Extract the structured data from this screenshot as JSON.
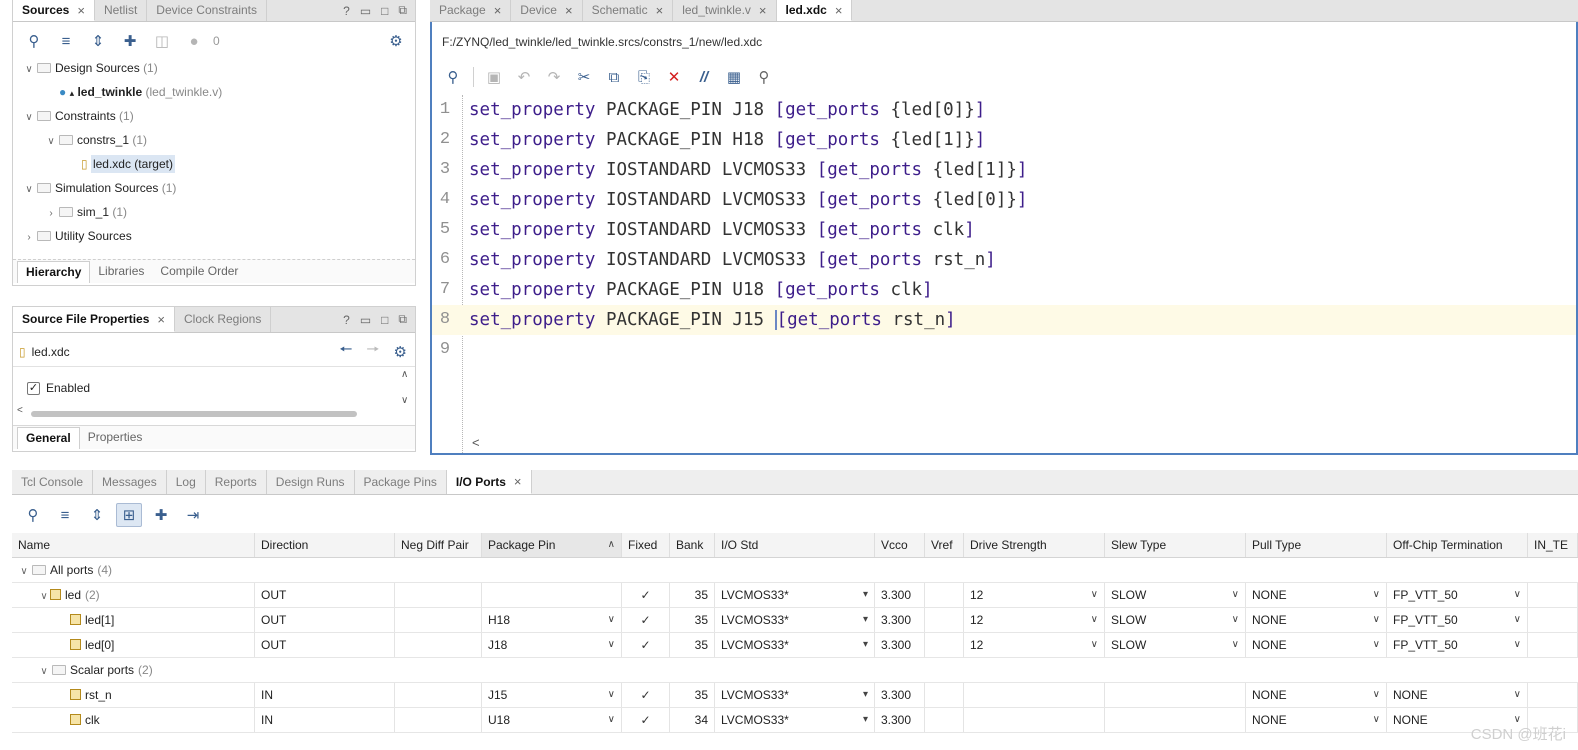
{
  "sources_panel": {
    "tabs": [
      "Sources",
      "Netlist",
      "Device Constraints"
    ],
    "close": "×",
    "win_buttons": [
      "?",
      "▭",
      "□",
      "⧉"
    ],
    "count_badge": "0",
    "tree": [
      {
        "label": "Design Sources",
        "count": "(1)"
      },
      {
        "label": "led_twinkle",
        "suffix": "(led_twinkle.v)"
      },
      {
        "label": "Constraints",
        "count": "(1)"
      },
      {
        "label": "constrs_1",
        "count": "(1)"
      },
      {
        "label": "led.xdc (target)"
      },
      {
        "label": "Simulation Sources",
        "count": "(1)"
      },
      {
        "label": "sim_1",
        "count": "(1)"
      },
      {
        "label": "Utility Sources"
      }
    ],
    "bottom_tabs": [
      "Hierarchy",
      "Libraries",
      "Compile Order"
    ]
  },
  "props_panel": {
    "tabs": [
      "Source File Properties",
      "Clock Regions"
    ],
    "file": "led.xdc",
    "enabled_label": "Enabled",
    "enabled": true,
    "bottom_tabs": [
      "General",
      "Properties"
    ]
  },
  "editor": {
    "tabs": [
      "Package",
      "Device",
      "Schematic",
      "led_twinkle.v",
      "led.xdc"
    ],
    "path": "F:/ZYNQ/led_twinkle/led_twinkle.srcs/constrs_1/new/led.xdc",
    "lines": [
      {
        "n": "1",
        "kw": "set_property",
        "prop": " PACKAGE_PIN J18 ",
        "ob": "[",
        "cmd": "get_ports",
        "arg": " {led[0]}",
        "cb": "]"
      },
      {
        "n": "2",
        "kw": "set_property",
        "prop": " PACKAGE_PIN H18 ",
        "ob": "[",
        "cmd": "get_ports",
        "arg": " {led[1]}",
        "cb": "]"
      },
      {
        "n": "3",
        "kw": "set_property",
        "prop": " IOSTANDARD LVCMOS33 ",
        "ob": "[",
        "cmd": "get_ports",
        "arg": " {led[1]}",
        "cb": "]"
      },
      {
        "n": "4",
        "kw": "set_property",
        "prop": " IOSTANDARD LVCMOS33 ",
        "ob": "[",
        "cmd": "get_ports",
        "arg": " {led[0]}",
        "cb": "]"
      },
      {
        "n": "5",
        "kw": "set_property",
        "prop": " IOSTANDARD LVCMOS33 ",
        "ob": "[",
        "cmd": "get_ports",
        "arg": " clk",
        "cb": "]"
      },
      {
        "n": "6",
        "kw": "set_property",
        "prop": " IOSTANDARD LVCMOS33 ",
        "ob": "[",
        "cmd": "get_ports",
        "arg": " rst_n",
        "cb": "]"
      },
      {
        "n": "7",
        "kw": "set_property",
        "prop": " PACKAGE_PIN U18 ",
        "ob": "[",
        "cmd": "get_ports",
        "arg": " clk",
        "cb": "]"
      },
      {
        "n": "8",
        "kw": "set_property",
        "prop": " PACKAGE_PIN J15 ",
        "ob": "[",
        "cmd": "get_ports",
        "arg": " rst_n",
        "cb": "]"
      },
      {
        "n": "9",
        "kw": "",
        "prop": "",
        "ob": "",
        "cmd": "",
        "arg": "",
        "cb": ""
      }
    ],
    "scroll_left": "<"
  },
  "bottom": {
    "tabs": [
      "Tcl Console",
      "Messages",
      "Log",
      "Reports",
      "Design Runs",
      "Package Pins",
      "I/O Ports"
    ],
    "columns": [
      "Name",
      "Direction",
      "Neg Diff Pair",
      "Package Pin",
      "Fixed",
      "Bank",
      "I/O Std",
      "Vcco",
      "Vref",
      "Drive Strength",
      "Slew Type",
      "Pull Type",
      "Off-Chip Termination",
      "IN_TE"
    ],
    "rows": [
      {
        "name": "All ports",
        "count": "(4)",
        "dir": "",
        "pin": "",
        "fixed": "",
        "bank": "",
        "iostd": "",
        "vcco": "",
        "drive": "",
        "slew": "",
        "pull": "",
        "term": ""
      },
      {
        "name": "led",
        "count": "(2)",
        "dir": "OUT",
        "pin": "",
        "fixed": "✓",
        "bank": "35",
        "iostd": "LVCMOS33*",
        "vcco": "3.300",
        "drive": "12",
        "slew": "SLOW",
        "pull": "NONE",
        "term": "FP_VTT_50"
      },
      {
        "name": "led[1]",
        "count": "",
        "dir": "OUT",
        "pin": "H18",
        "fixed": "✓",
        "bank": "35",
        "iostd": "LVCMOS33*",
        "vcco": "3.300",
        "drive": "12",
        "slew": "SLOW",
        "pull": "NONE",
        "term": "FP_VTT_50"
      },
      {
        "name": "led[0]",
        "count": "",
        "dir": "OUT",
        "pin": "J18",
        "fixed": "✓",
        "bank": "35",
        "iostd": "LVCMOS33*",
        "vcco": "3.300",
        "drive": "12",
        "slew": "SLOW",
        "pull": "NONE",
        "term": "FP_VTT_50"
      },
      {
        "name": "Scalar ports",
        "count": "(2)",
        "dir": "",
        "pin": "",
        "fixed": "",
        "bank": "",
        "iostd": "",
        "vcco": "",
        "drive": "",
        "slew": "",
        "pull": "",
        "term": ""
      },
      {
        "name": "rst_n",
        "count": "",
        "dir": "IN",
        "pin": "J15",
        "fixed": "✓",
        "bank": "35",
        "iostd": "LVCMOS33*",
        "vcco": "3.300",
        "drive": "",
        "slew": "",
        "pull": "NONE",
        "term": "NONE"
      },
      {
        "name": "clk",
        "count": "",
        "dir": "IN",
        "pin": "U18",
        "fixed": "✓",
        "bank": "34",
        "iostd": "LVCMOS33*",
        "vcco": "3.300",
        "drive": "",
        "slew": "",
        "pull": "NONE",
        "term": "NONE"
      }
    ]
  },
  "watermark": "CSDN @班花i"
}
